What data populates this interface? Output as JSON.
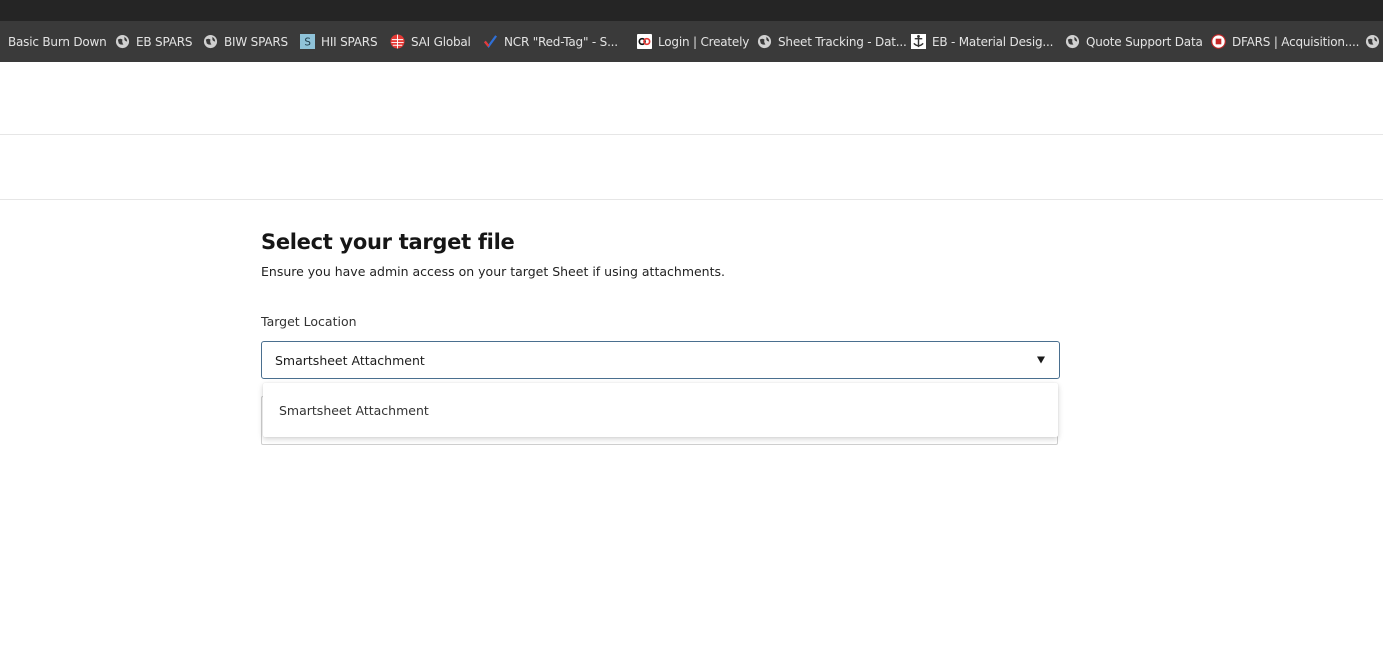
{
  "bookmarks": [
    {
      "label": "Basic Burn Down",
      "icon": "none"
    },
    {
      "label": "EB SPARS",
      "icon": "globe-icon"
    },
    {
      "label": "BIW SPARS",
      "icon": "globe-icon"
    },
    {
      "label": "HII SPARS",
      "icon": "s-square-icon"
    },
    {
      "label": "SAI Global",
      "icon": "sai-globe-icon"
    },
    {
      "label": "NCR \"Red-Tag\" - S...",
      "icon": "checkmark-icon"
    },
    {
      "label": "Login | Creately",
      "icon": "creately-icon"
    },
    {
      "label": "Sheet Tracking - Dat...",
      "icon": "globe-icon"
    },
    {
      "label": "EB - Material Desig...",
      "icon": "anchor-icon"
    },
    {
      "label": "Quote Support Data",
      "icon": "globe-icon"
    },
    {
      "label": "DFARS | Acquisition....",
      "icon": "dfars-seal-icon"
    },
    {
      "label": "",
      "icon": "globe-icon"
    }
  ],
  "page": {
    "title": "Select your target file",
    "subtitle": "Ensure you have admin access on your target Sheet if using attachments."
  },
  "target_location": {
    "label": "Target Location",
    "selected": "Smartsheet Attachment",
    "options": [
      "Smartsheet Attachment"
    ]
  },
  "colors": {
    "browser_bar": "#3a3a3a",
    "select_border": "#4a6f8f",
    "text": "#161616"
  }
}
